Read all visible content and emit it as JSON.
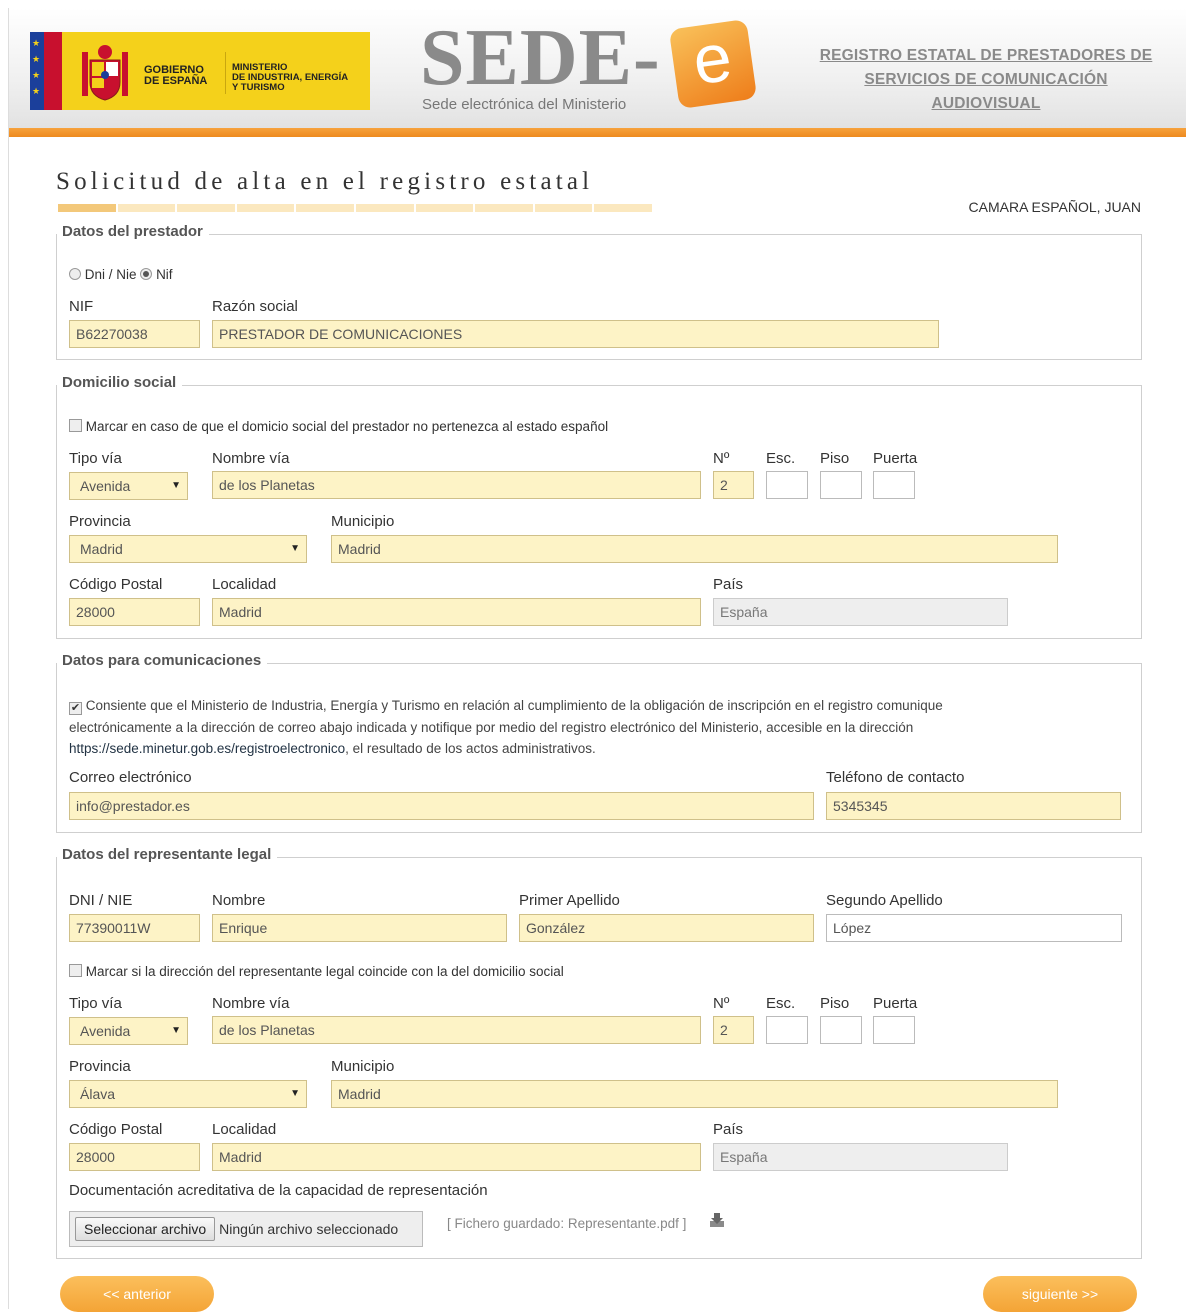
{
  "header": {
    "gov_label": "GOBIERNO\nDE ESPAÑA",
    "ministry_label": "MINISTERIO\nDE INDUSTRIA, ENERGÍA\nY TURISMO",
    "sede_title": "SEDE-",
    "sede_e": "e",
    "sede_subtitle": "Sede electrónica del Ministerio",
    "registry_link": "REGISTRO ESTATAL DE PRESTADORES DE SERVICIOS DE COMUNICACIÓN AUDIOVISUAL"
  },
  "page": {
    "title": "Solicitud de alta en el registro estatal",
    "user_name": "CAMARA ESPAÑOL, JUAN",
    "progress": {
      "total_steps": 10,
      "completed_steps": 1
    }
  },
  "prestador": {
    "legend": "Datos del prestador",
    "radio_dni": "Dni / Nie",
    "radio_nif": "Nif",
    "nif_label": "NIF",
    "nif_value": "B62270038",
    "razon_label": "Razón social",
    "razon_value": "PRESTADOR DE COMUNICACIONES"
  },
  "domicilio": {
    "legend": "Domicilio social",
    "foreign_check": "Marcar en caso de que el domicio social del prestador no pertenezca al estado español",
    "tipo_via_label": "Tipo vía",
    "tipo_via_value": "Avenida",
    "nombre_via_label": "Nombre vía",
    "nombre_via_value": "de los Planetas",
    "numero_label": "Nº",
    "numero_value": "2",
    "esc_label": "Esc.",
    "piso_label": "Piso",
    "puerta_label": "Puerta",
    "provincia_label": "Provincia",
    "provincia_value": "Madrid",
    "municipio_label": "Municipio",
    "municipio_value": "Madrid",
    "cp_label": "Código Postal",
    "cp_value": "28000",
    "localidad_label": "Localidad",
    "localidad_value": "Madrid",
    "pais_label": "País",
    "pais_value": "España"
  },
  "comunicaciones": {
    "legend": "Datos para comunicaciones",
    "consent_text_1": "Consiente que el Ministerio de Industria, Energía y Turismo en relación al cumplimiento de la obligación de inscripción en el registro comunique",
    "consent_text_2": "electrónicamente a la dirección de correo abajo indicada y notifique por medio del registro electrónico del Ministerio, accesible en la dirección",
    "consent_link": "https://sede.minetur.gob.es/registroelectronico",
    "consent_text_3": ", el resultado de los actos administrativos.",
    "email_label": "Correo electrónico",
    "email_value": "info@prestador.es",
    "phone_label": "Teléfono de contacto",
    "phone_value": "5345345"
  },
  "representante": {
    "legend": "Datos del representante legal",
    "dni_label": "DNI / NIE",
    "dni_value": "77390011W",
    "nombre_label": "Nombre",
    "nombre_value": "Enrique",
    "apellido1_label": "Primer Apellido",
    "apellido1_value": "González",
    "apellido2_label": "Segundo Apellido",
    "apellido2_value": "López",
    "same_address_check": "Marcar si la dirección del representante legal coincide con la del domicilio social",
    "tipo_via_label": "Tipo vía",
    "tipo_via_value": "Avenida",
    "nombre_via_label": "Nombre vía",
    "nombre_via_value": "de los Planetas",
    "numero_label": "Nº",
    "numero_value": "2",
    "esc_label": "Esc.",
    "piso_label": "Piso",
    "puerta_label": "Puerta",
    "provincia_label": "Provincia",
    "provincia_value": "Álava",
    "municipio_label": "Municipio",
    "municipio_value": "Madrid",
    "cp_label": "Código Postal",
    "cp_value": "28000",
    "localidad_label": "Localidad",
    "localidad_value": "Madrid",
    "pais_label": "País",
    "pais_value": "España",
    "doc_label": "Documentación acreditativa de la capacidad de representación",
    "file_button": "Seleccionar archivo",
    "file_none": "Ningún archivo seleccionado",
    "saved_file": "[ Fichero guardado: Representante.pdf ]"
  },
  "nav": {
    "prev": "<< anterior",
    "next": "siguiente >>"
  },
  "colors": {
    "accent_orange": "#f4a436",
    "input_yellow": "#fdf3c6",
    "gov_yellow": "#f4d11b"
  }
}
